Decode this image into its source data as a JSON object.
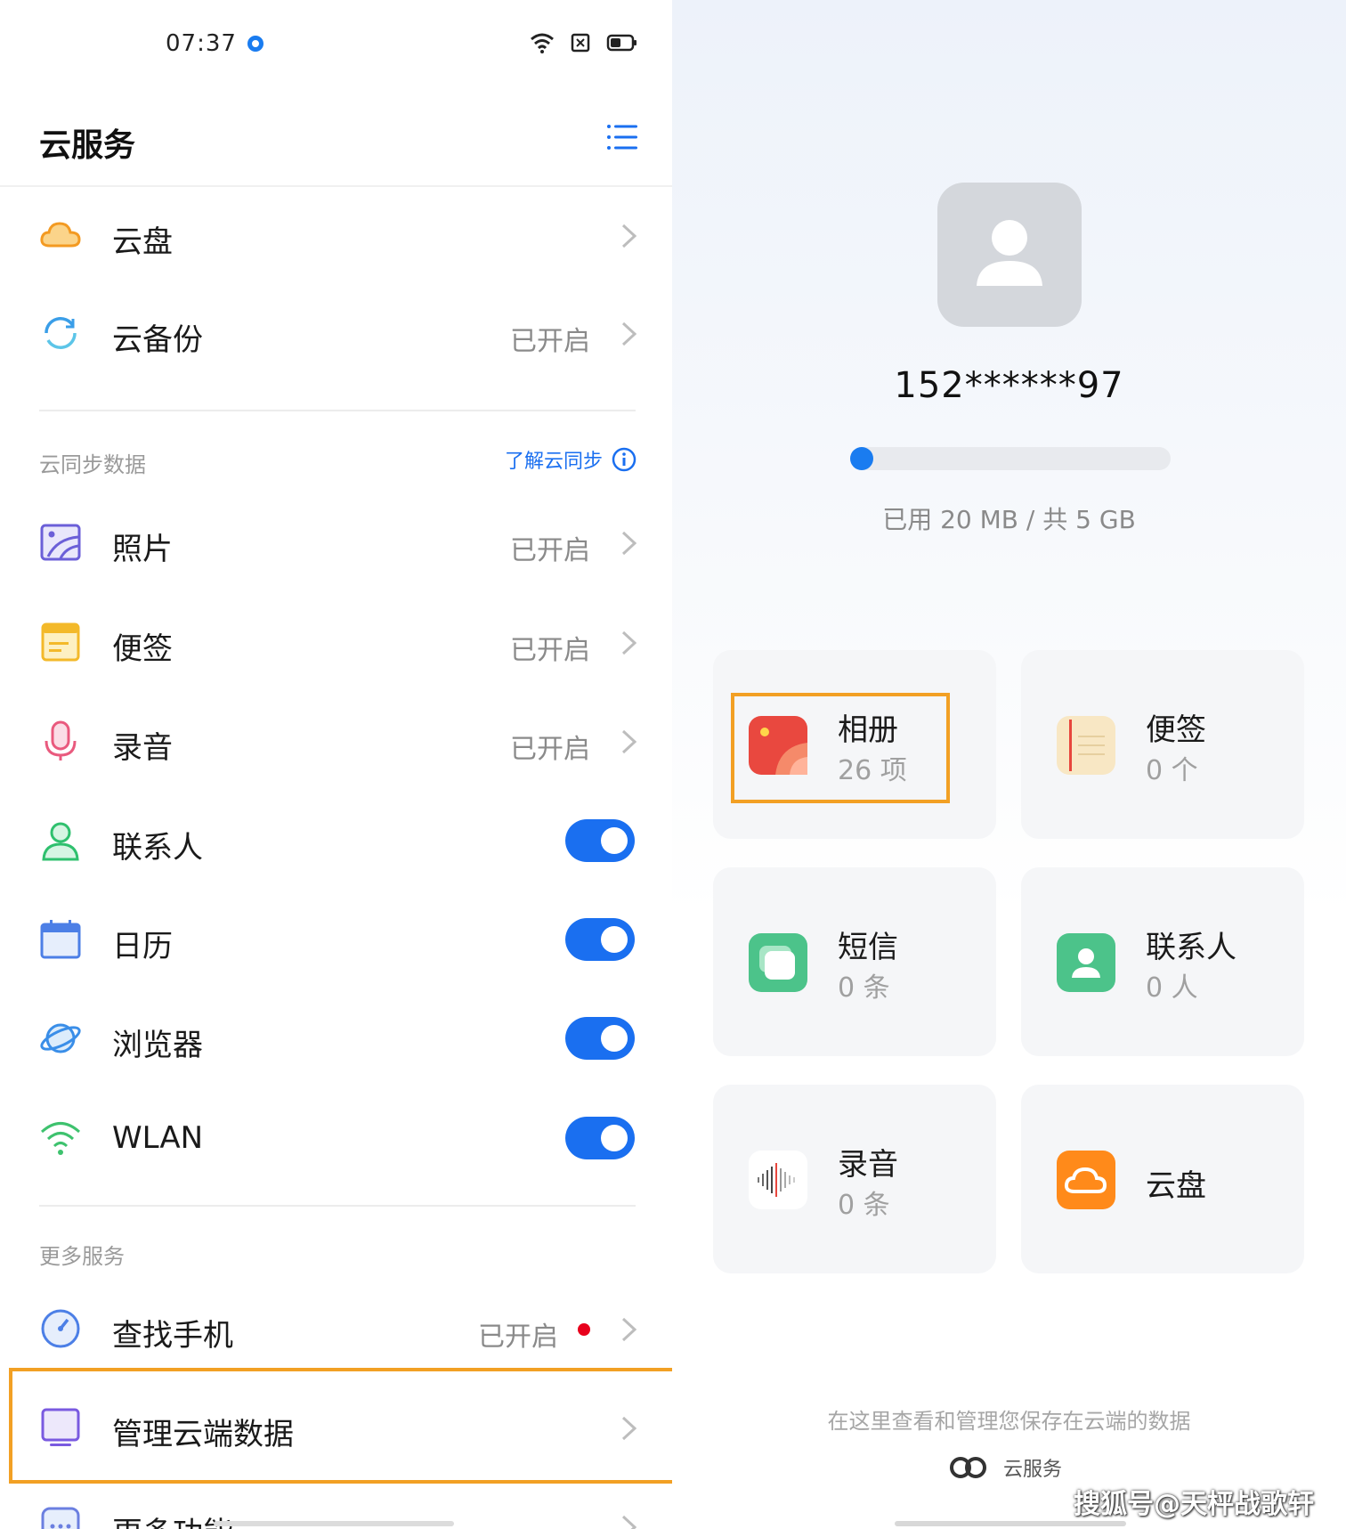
{
  "status_bar": {
    "time": "07:37"
  },
  "header": {
    "title": "云服务",
    "menu_icon": "list-icon"
  },
  "top_items": [
    {
      "label": "云盘",
      "status": "",
      "icon": "cloud-icon"
    },
    {
      "label": "云备份",
      "status": "已开启",
      "icon": "sync-icon"
    }
  ],
  "sync_section": {
    "heading": "云同步数据",
    "learn_link": "了解云同步",
    "items": [
      {
        "label": "照片",
        "status": "已开启"
      },
      {
        "label": "便签",
        "status": "已开启"
      },
      {
        "label": "录音",
        "status": "已开启"
      },
      {
        "label": "联系人",
        "toggle": true
      },
      {
        "label": "日历",
        "toggle": true
      },
      {
        "label": "浏览器",
        "toggle": true
      },
      {
        "label": "WLAN",
        "toggle": true
      }
    ]
  },
  "more_section": {
    "heading": "更多服务",
    "items": [
      {
        "label": "查找手机",
        "status": "已开启"
      },
      {
        "label": "管理云端数据",
        "status": ""
      },
      {
        "label": "更多功能",
        "status": ""
      }
    ]
  },
  "account": {
    "phone": "152******97",
    "usage_text": "已用 20 MB / 共 5 GB",
    "usage_fraction": 0.004
  },
  "cards": [
    {
      "name": "相册",
      "count": "26 项",
      "color": "#e9483f"
    },
    {
      "name": "便签",
      "count": "0 个",
      "color": "#f8e7c4"
    },
    {
      "name": "短信",
      "count": "0 条",
      "color": "#4cc38a"
    },
    {
      "name": "联系人",
      "count": "0 人",
      "color": "#4cc38a"
    },
    {
      "name": "录音",
      "count": "0 条",
      "color": "#ffffff"
    },
    {
      "name": "云盘",
      "count": "",
      "color": "#ff8a1a"
    }
  ],
  "footer": {
    "note": "在这里查看和管理您保存在云端的数据",
    "brand": "云服务",
    "watermark": "搜狐号@天枰战歌轩"
  },
  "colors": {
    "accent": "#1a6ff0",
    "highlight": "#f2a024"
  }
}
